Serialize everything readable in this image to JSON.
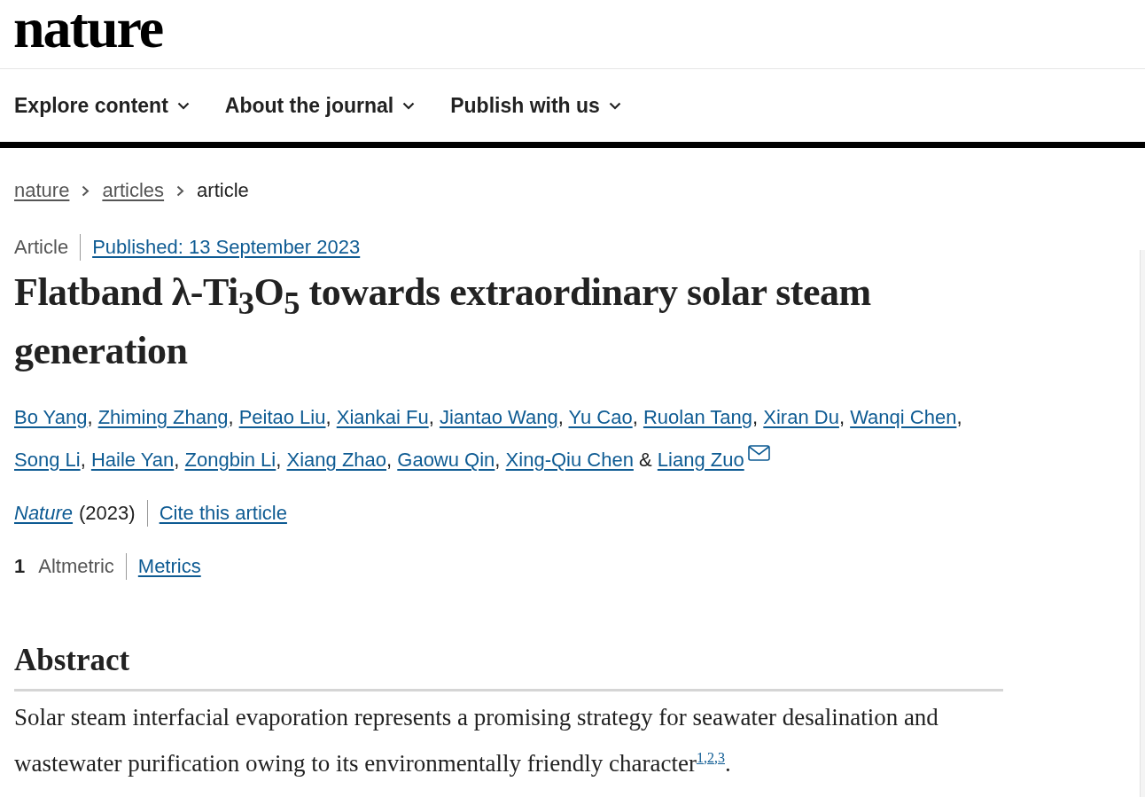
{
  "logo": "nature",
  "nav": [
    {
      "label": "Explore content",
      "expanded": false
    },
    {
      "label": "About the journal",
      "expanded": false
    },
    {
      "label": "Publish with us",
      "expanded": false
    }
  ],
  "breadcrumbs": [
    {
      "label": "nature",
      "link": true
    },
    {
      "label": "articles",
      "link": true
    },
    {
      "label": "article",
      "link": false
    }
  ],
  "article_type": "Article",
  "published": "Published: 13 September 2023",
  "title": "Flatband λ-Ti$_{3}$O$_{5}$ towards extraordinary solar steam generation",
  "authors": [
    {
      "name": "Bo Yang",
      "corresponding": false,
      "separator": ","
    },
    {
      "name": "Zhiming Zhang",
      "corresponding": false,
      "separator": ","
    },
    {
      "name": "Peitao Liu",
      "corresponding": false,
      "separator": ","
    },
    {
      "name": "Xiankai Fu",
      "corresponding": false,
      "separator": ","
    },
    {
      "name": "Jiantao Wang",
      "corresponding": false,
      "separator": ","
    },
    {
      "name": "Yu Cao",
      "corresponding": false,
      "separator": ","
    },
    {
      "name": "Ruolan Tang",
      "corresponding": false,
      "separator": ","
    },
    {
      "name": "Xiran Du",
      "corresponding": false,
      "separator": ","
    },
    {
      "name": "Wanqi Chen",
      "corresponding": false,
      "separator": ","
    },
    {
      "name": "Song Li",
      "corresponding": false,
      "separator": ","
    },
    {
      "name": "Haile Yan",
      "corresponding": false,
      "separator": ","
    },
    {
      "name": "Zongbin Li",
      "corresponding": false,
      "separator": ","
    },
    {
      "name": "Xiang Zhao",
      "corresponding": false,
      "separator": ","
    },
    {
      "name": "Gaowu Qin",
      "corresponding": false,
      "separator": ","
    },
    {
      "name": "Xing-Qiu Chen",
      "corresponding": false,
      "separator": "&"
    },
    {
      "name": "Liang Zuo",
      "corresponding": true
    }
  ],
  "journal": "Nature",
  "year": "(2023)",
  "cite": "Cite this article",
  "altmetric_count": "1",
  "altmetric_label": "Altmetric",
  "metrics": "Metrics",
  "abstract": {
    "heading": "Abstract",
    "text": "Solar steam interfacial evaporation represents a promising strategy for seawater desalination and wastewater purification owing to its environmentally friendly character",
    "references": [
      {
        "label": "1",
        "separator": ","
      },
      {
        "label": "2",
        "separator": ","
      },
      {
        "label": "3"
      }
    ],
    "end": "."
  }
}
